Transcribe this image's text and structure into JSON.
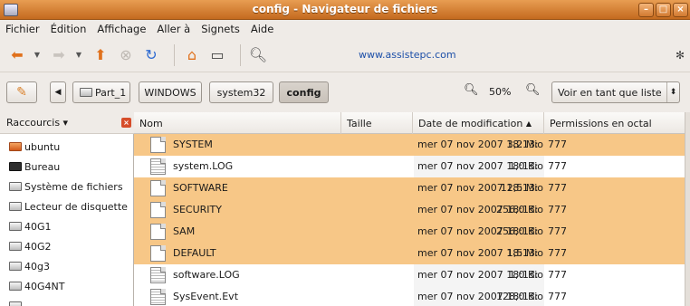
{
  "window": {
    "title": "config - Navigateur de fichiers"
  },
  "menu": [
    "Fichier",
    "Édition",
    "Affichage",
    "Aller à",
    "Signets",
    "Aide"
  ],
  "toolbar": {
    "url": "www.assistepc.com"
  },
  "pathbar": {
    "segments": [
      "Part_1",
      "WINDOWS",
      "system32",
      "config"
    ]
  },
  "zoom": "50%",
  "view_mode": "Voir en tant que liste",
  "sidebar": {
    "title": "Raccourcis",
    "items": [
      {
        "label": "ubuntu",
        "icon": "home-folder-icon"
      },
      {
        "label": "Bureau",
        "icon": "desktop-icon"
      },
      {
        "label": "Système de fichiers",
        "icon": "drive-icon"
      },
      {
        "label": "Lecteur de disquette",
        "icon": "floppy-icon"
      },
      {
        "label": "40G1",
        "icon": "drive-icon"
      },
      {
        "label": "40G2",
        "icon": "drive-icon"
      },
      {
        "label": "40g3",
        "icon": "drive-icon"
      },
      {
        "label": "40G4NT",
        "icon": "drive-icon"
      },
      {
        "label": "",
        "icon": "drive-icon"
      }
    ]
  },
  "columns": {
    "name": "Nom",
    "size": "Taille",
    "modified": "Date de modification",
    "perms": "Permissions en octal"
  },
  "files": [
    {
      "name": "SYSTEM",
      "size": "3,2 Mio",
      "date": "mer 07 nov 2007 18:13:",
      "perms": "777",
      "selected": true,
      "type": "binary"
    },
    {
      "name": "system.LOG",
      "size": "1,0 Kio",
      "date": "mer 07 nov 2007 18:13:",
      "perms": "777",
      "selected": false,
      "type": "text"
    },
    {
      "name": "SOFTWARE",
      "size": "12,5 Mio",
      "date": "mer 07 nov 2007 18:13:",
      "perms": "777",
      "selected": true,
      "type": "binary"
    },
    {
      "name": "SECURITY",
      "size": "256,0 Kio",
      "date": "mer 07 nov 2007 18:13:",
      "perms": "777",
      "selected": true,
      "type": "binary"
    },
    {
      "name": "SAM",
      "size": "256,0 Kio",
      "date": "mer 07 nov 2007 18:13:",
      "perms": "777",
      "selected": true,
      "type": "binary"
    },
    {
      "name": "DEFAULT",
      "size": "1,5 Mio",
      "date": "mer 07 nov 2007 18:13:",
      "perms": "777",
      "selected": true,
      "type": "binary"
    },
    {
      "name": "software.LOG",
      "size": "1,0 Kio",
      "date": "mer 07 nov 2007 18:13:",
      "perms": "777",
      "selected": false,
      "type": "text"
    },
    {
      "name": "SysEvent.Evt",
      "size": "128,0 Kio",
      "date": "mer 07 nov 2007 18:13:",
      "perms": "777",
      "selected": false,
      "type": "text"
    }
  ]
}
